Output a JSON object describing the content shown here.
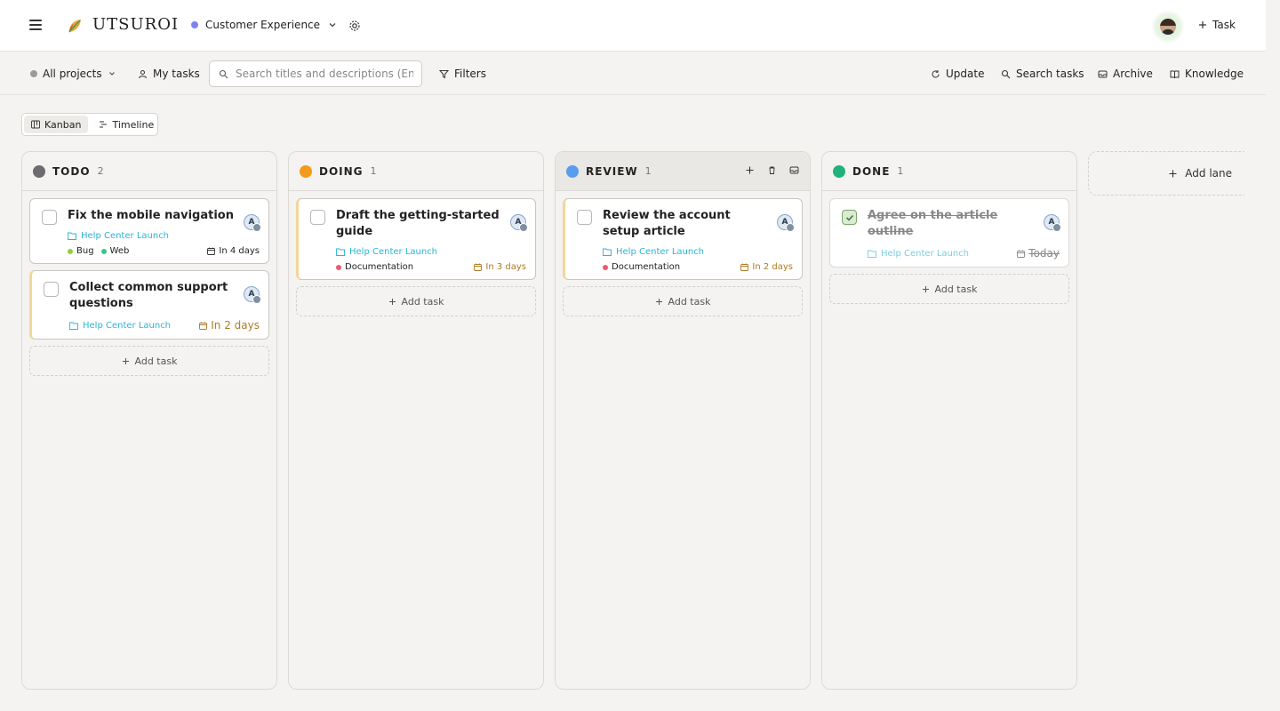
{
  "app": {
    "logo_text": "UTSUROI"
  },
  "header": {
    "workspace": "Customer Experience",
    "task_button": "Task"
  },
  "toolbar": {
    "all_projects": "All projects",
    "my_tasks": "My tasks",
    "search_placeholder": "Search titles and descriptions (Enter)",
    "filters": "Filters",
    "update": "Update",
    "search_tasks": "Search tasks",
    "archive": "Archive",
    "knowledge": "Knowledge"
  },
  "views": {
    "kanban": "Kanban",
    "timeline": "Timeline"
  },
  "colors": {
    "todo": "#6b6b70",
    "doing": "#f29a1c",
    "review": "#5b9cf0",
    "done": "#1fb27a",
    "accent": "#2ab5d4"
  },
  "lanes": [
    {
      "title": "TODO",
      "count": "2",
      "cards": [
        {
          "title": "Fix the mobile navigation",
          "avatar": "A",
          "project": "Help Center Launch",
          "tags": [
            "Bug",
            "Web"
          ],
          "due": "In 4 days"
        },
        {
          "title": "Collect common support questions",
          "avatar": "A",
          "project": "Help Center Launch",
          "due": "In 2 days"
        }
      ],
      "add_task": "Add task"
    },
    {
      "title": "DOING",
      "count": "1",
      "cards": [
        {
          "title": "Draft the getting-started guide",
          "avatar": "A",
          "project": "Help Center Launch",
          "tags": [
            "Documentation"
          ],
          "due": "In 3 days"
        }
      ],
      "add_task": "Add task"
    },
    {
      "title": "REVIEW",
      "count": "1",
      "cards": [
        {
          "title": "Review the account setup article",
          "avatar": "A",
          "project": "Help Center Launch",
          "tags": [
            "Documentation"
          ],
          "due": "In 2 days"
        }
      ],
      "add_task": "Add task"
    },
    {
      "title": "DONE",
      "count": "1",
      "cards": [
        {
          "title": "Agree on the article outline",
          "avatar": "A",
          "project": "Help Center Launch",
          "due": "Today"
        }
      ],
      "add_task": "Add task"
    }
  ],
  "add_lane": "Add lane"
}
